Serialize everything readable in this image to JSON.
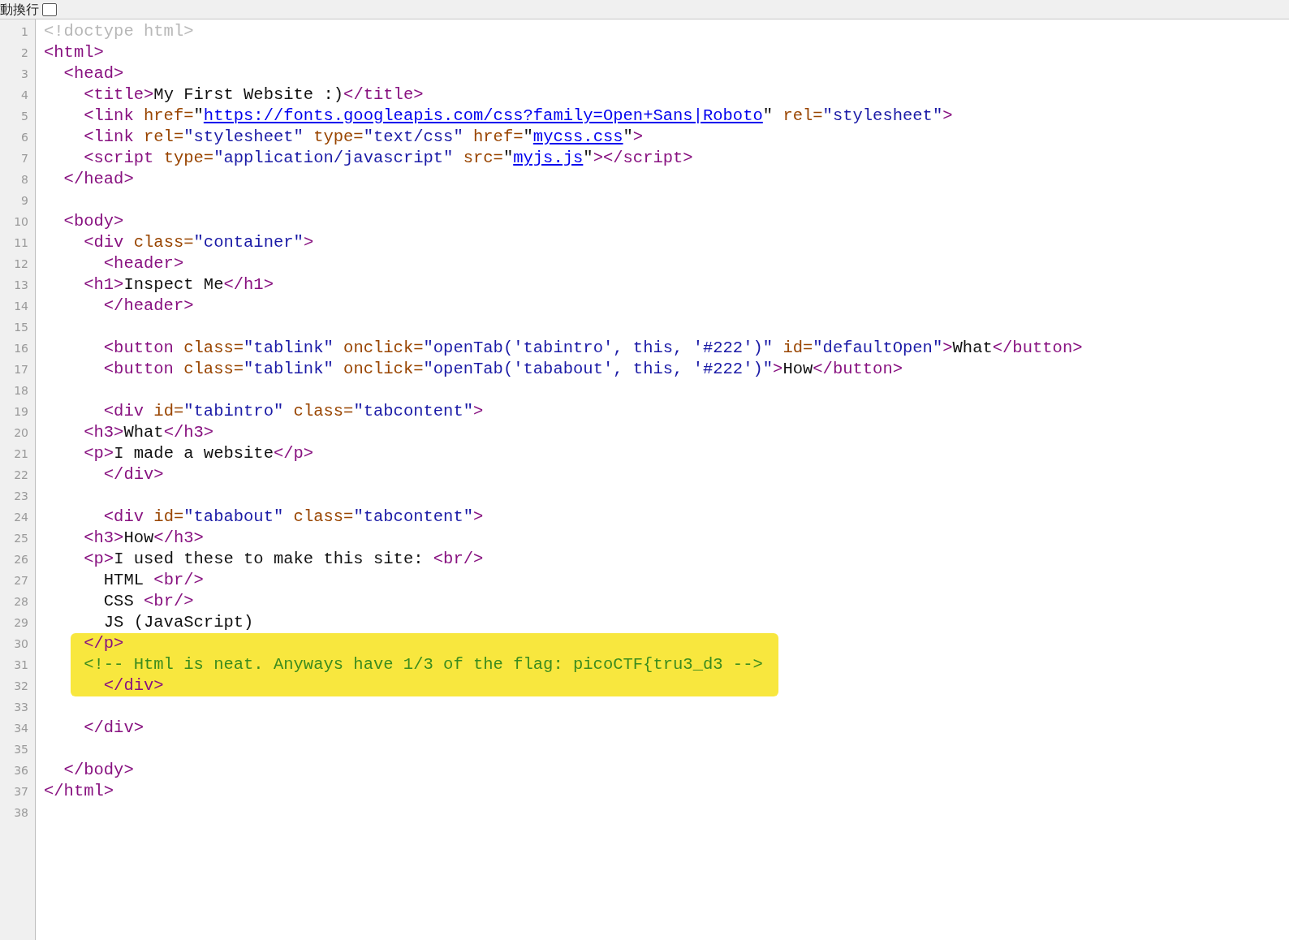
{
  "toolbar": {
    "wrap_label": "動換行",
    "wrap_checked": false
  },
  "lines": [
    {
      "number": "1",
      "tokens": [
        {
          "kind": "doctype",
          "text": "<!doctype html>"
        }
      ]
    },
    {
      "number": "2",
      "tokens": [
        {
          "kind": "tag",
          "text": "<html>"
        }
      ]
    },
    {
      "number": "3",
      "tokens": [
        {
          "kind": "tag",
          "text": "  <head>"
        }
      ]
    },
    {
      "number": "4",
      "tokens": [
        {
          "kind": "tag",
          "text": "    <title>"
        },
        {
          "kind": "text",
          "text": "My First Website :)"
        },
        {
          "kind": "tag",
          "text": "</title>"
        }
      ]
    },
    {
      "number": "5",
      "tokens": [
        {
          "kind": "tag",
          "text": "    <link"
        },
        {
          "kind": "attr",
          "text": " href="
        },
        {
          "kind": "text",
          "text": "\""
        },
        {
          "kind": "link",
          "text": "https://fonts.googleapis.com/css?family=Open+Sans|Roboto"
        },
        {
          "kind": "text",
          "text": "\""
        },
        {
          "kind": "attr",
          "text": " rel="
        },
        {
          "kind": "value",
          "text": "\"stylesheet\""
        },
        {
          "kind": "tag",
          "text": ">"
        }
      ]
    },
    {
      "number": "6",
      "tokens": [
        {
          "kind": "tag",
          "text": "    <link"
        },
        {
          "kind": "attr",
          "text": " rel="
        },
        {
          "kind": "value",
          "text": "\"stylesheet\""
        },
        {
          "kind": "attr",
          "text": " type="
        },
        {
          "kind": "value",
          "text": "\"text/css\""
        },
        {
          "kind": "attr",
          "text": " href="
        },
        {
          "kind": "text",
          "text": "\""
        },
        {
          "kind": "link",
          "text": "mycss.css"
        },
        {
          "kind": "text",
          "text": "\""
        },
        {
          "kind": "tag",
          "text": ">"
        }
      ]
    },
    {
      "number": "7",
      "tokens": [
        {
          "kind": "tag",
          "text": "    <script"
        },
        {
          "kind": "attr",
          "text": " type="
        },
        {
          "kind": "value",
          "text": "\"application/javascript\""
        },
        {
          "kind": "attr",
          "text": " src="
        },
        {
          "kind": "text",
          "text": "\""
        },
        {
          "kind": "link",
          "text": "myjs.js"
        },
        {
          "kind": "text",
          "text": "\""
        },
        {
          "kind": "tag",
          "text": "></script>"
        }
      ]
    },
    {
      "number": "8",
      "tokens": [
        {
          "kind": "tag",
          "text": "  </head>"
        }
      ]
    },
    {
      "number": "9"
    },
    {
      "number": "10",
      "tokens": [
        {
          "kind": "tag",
          "text": "  <body>"
        }
      ]
    },
    {
      "number": "11",
      "tokens": [
        {
          "kind": "tag",
          "text": "    <div"
        },
        {
          "kind": "attr",
          "text": " class="
        },
        {
          "kind": "value",
          "text": "\"container\""
        },
        {
          "kind": "tag",
          "text": ">"
        }
      ]
    },
    {
      "number": "12",
      "tokens": [
        {
          "kind": "tag",
          "text": "      <header>"
        }
      ]
    },
    {
      "number": "13",
      "tokens": [
        {
          "kind": "tag",
          "text": "    <h1>"
        },
        {
          "kind": "text",
          "text": "Inspect Me"
        },
        {
          "kind": "tag",
          "text": "</h1>"
        }
      ]
    },
    {
      "number": "14",
      "tokens": [
        {
          "kind": "tag",
          "text": "      </header>"
        }
      ]
    },
    {
      "number": "15"
    },
    {
      "number": "16",
      "tokens": [
        {
          "kind": "tag",
          "text": "      <button"
        },
        {
          "kind": "attr",
          "text": " class="
        },
        {
          "kind": "value",
          "text": "\"tablink\""
        },
        {
          "kind": "attr",
          "text": " onclick="
        },
        {
          "kind": "value",
          "text": "\"openTab('tabintro', this, '#222')\""
        },
        {
          "kind": "attr",
          "text": " id="
        },
        {
          "kind": "value",
          "text": "\"defaultOpen\""
        },
        {
          "kind": "tag",
          "text": ">"
        },
        {
          "kind": "text",
          "text": "What"
        },
        {
          "kind": "tag",
          "text": "</button>"
        }
      ]
    },
    {
      "number": "17",
      "tokens": [
        {
          "kind": "tag",
          "text": "      <button"
        },
        {
          "kind": "attr",
          "text": " class="
        },
        {
          "kind": "value",
          "text": "\"tablink\""
        },
        {
          "kind": "attr",
          "text": " onclick="
        },
        {
          "kind": "value",
          "text": "\"openTab('tababout', this, '#222')\""
        },
        {
          "kind": "tag",
          "text": ">"
        },
        {
          "kind": "text",
          "text": "How"
        },
        {
          "kind": "tag",
          "text": "</button>"
        }
      ]
    },
    {
      "number": "18"
    },
    {
      "number": "19",
      "tokens": [
        {
          "kind": "tag",
          "text": "      <div"
        },
        {
          "kind": "attr",
          "text": " id="
        },
        {
          "kind": "value",
          "text": "\"tabintro\""
        },
        {
          "kind": "attr",
          "text": " class="
        },
        {
          "kind": "value",
          "text": "\"tabcontent\""
        },
        {
          "kind": "tag",
          "text": ">"
        }
      ]
    },
    {
      "number": "20",
      "tokens": [
        {
          "kind": "tag",
          "text": "    <h3>"
        },
        {
          "kind": "text",
          "text": "What"
        },
        {
          "kind": "tag",
          "text": "</h3>"
        }
      ]
    },
    {
      "number": "21",
      "tokens": [
        {
          "kind": "tag",
          "text": "    <p>"
        },
        {
          "kind": "text",
          "text": "I made a website"
        },
        {
          "kind": "tag",
          "text": "</p>"
        }
      ]
    },
    {
      "number": "22",
      "tokens": [
        {
          "kind": "tag",
          "text": "      </div>"
        }
      ]
    },
    {
      "number": "23"
    },
    {
      "number": "24",
      "tokens": [
        {
          "kind": "tag",
          "text": "      <div"
        },
        {
          "kind": "attr",
          "text": " id="
        },
        {
          "kind": "value",
          "text": "\"tababout\""
        },
        {
          "kind": "attr",
          "text": " class="
        },
        {
          "kind": "value",
          "text": "\"tabcontent\""
        },
        {
          "kind": "tag",
          "text": ">"
        }
      ]
    },
    {
      "number": "25",
      "tokens": [
        {
          "kind": "tag",
          "text": "    <h3>"
        },
        {
          "kind": "text",
          "text": "How"
        },
        {
          "kind": "tag",
          "text": "</h3>"
        }
      ]
    },
    {
      "number": "26",
      "tokens": [
        {
          "kind": "tag",
          "text": "    <p>"
        },
        {
          "kind": "text",
          "text": "I used these to make this site: "
        },
        {
          "kind": "tag",
          "text": "<br/>"
        }
      ]
    },
    {
      "number": "27",
      "tokens": [
        {
          "kind": "text",
          "text": "      HTML "
        },
        {
          "kind": "tag",
          "text": "<br/>"
        }
      ]
    },
    {
      "number": "28",
      "tokens": [
        {
          "kind": "text",
          "text": "      CSS "
        },
        {
          "kind": "tag",
          "text": "<br/>"
        }
      ]
    },
    {
      "number": "29",
      "tokens": [
        {
          "kind": "text",
          "text": "      JS (JavaScript)"
        }
      ]
    },
    {
      "number": "30",
      "highlighted": true,
      "tokens": [
        {
          "kind": "tag",
          "text": "    </p>"
        }
      ]
    },
    {
      "number": "31",
      "highlighted": true,
      "tokens": [
        {
          "kind": "comment",
          "text": "    <!-- Html is neat. Anyways have 1/3 of the flag: picoCTF{tru3_d3 -->"
        }
      ]
    },
    {
      "number": "32",
      "highlighted": true,
      "tokens": [
        {
          "kind": "tag",
          "text": "      </div>"
        }
      ]
    },
    {
      "number": "33"
    },
    {
      "number": "34",
      "tokens": [
        {
          "kind": "tag",
          "text": "    </div>"
        }
      ]
    },
    {
      "number": "35"
    },
    {
      "number": "36",
      "tokens": [
        {
          "kind": "tag",
          "text": "  </body>"
        }
      ]
    },
    {
      "number": "37",
      "tokens": [
        {
          "kind": "tag",
          "text": "</html>"
        }
      ]
    },
    {
      "number": "38"
    }
  ]
}
